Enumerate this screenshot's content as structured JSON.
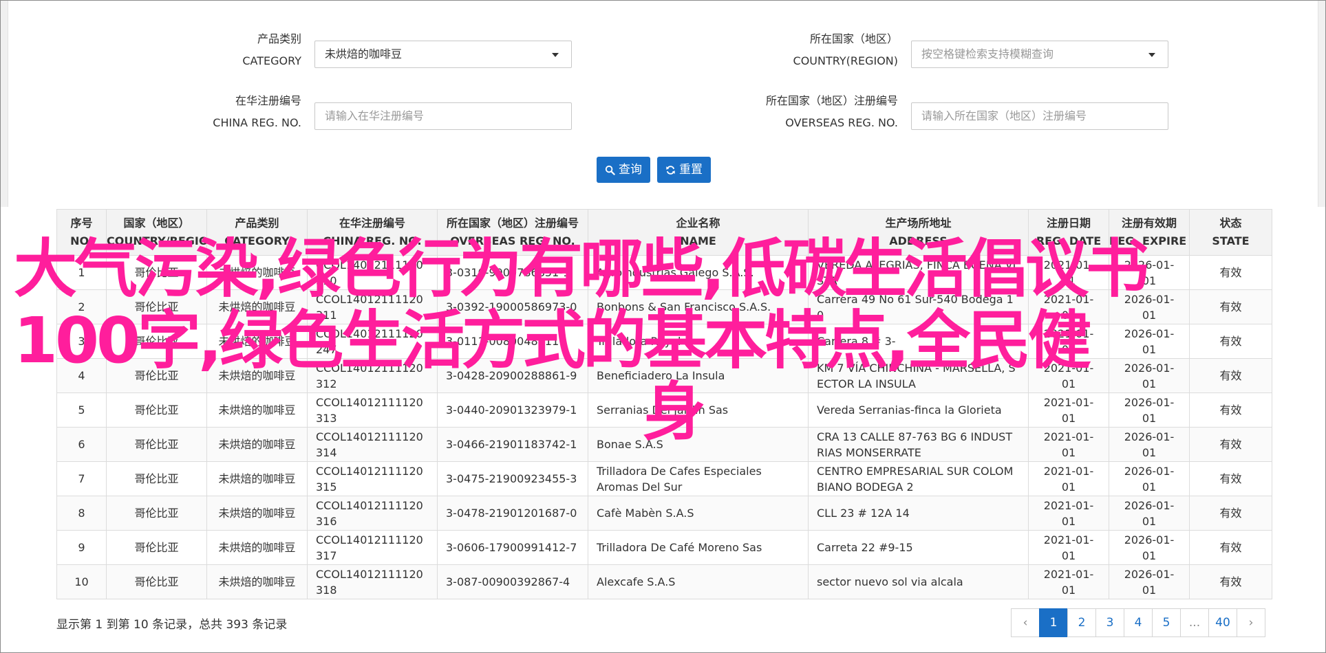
{
  "filters": {
    "category_label_cn": "产品类别",
    "category_label_en": "CATEGORY",
    "category_value": "未烘焙的咖啡豆",
    "country_label_cn": "所在国家（地区）",
    "country_label_en": "COUNTRY(REGION)",
    "country_placeholder": "按空格键检索支持模糊查询",
    "china_reg_label_cn": "在华注册编号",
    "china_reg_label_en": "CHINA REG. NO.",
    "china_reg_placeholder": "请输入在华注册编号",
    "overseas_reg_label_cn": "所在国家（地区）注册编号",
    "overseas_reg_label_en": "OVERSEAS REG. NO.",
    "overseas_reg_placeholder": "请输入所在国家（地区）注册编号",
    "search_label": "查询",
    "reset_label": "重置"
  },
  "table": {
    "columns": [
      {
        "cn": "序号",
        "en": "NO."
      },
      {
        "cn": "国家（地区）",
        "en": "COUNTRY/REGIO"
      },
      {
        "cn": "产品类别",
        "en": "CATEGORY"
      },
      {
        "cn": "在华注册编号",
        "en": "CHINA REG. NO."
      },
      {
        "cn": "所在国家（地区）注册编号",
        "en": "OVERSEAS REG. NO."
      },
      {
        "cn": "企业名称",
        "en": "NAME"
      },
      {
        "cn": "生产场所地址",
        "en": "ADDRESS"
      },
      {
        "cn": "注册日期",
        "en": "REG. DATE"
      },
      {
        "cn": "注册有效期",
        "en": "REG. EXPIRE ..."
      },
      {
        "cn": "状态",
        "en": "STATE"
      }
    ],
    "rows": [
      {
        "no": "1",
        "country": "哥伦比亚",
        "category": "未烘焙的咖啡豆",
        "china_reg": "CCOL14012111120310",
        "overseas_reg": "3-0310-9900786851-1",
        "name": "Agroindustrias Galego S.A.S.",
        "address": "VEREDA ALEGRIAS, FINCA BUENA VISTA",
        "reg_date": "2021-01-01",
        "expire": "2026-01-01",
        "state": "有效"
      },
      {
        "no": "2",
        "country": "哥伦比亚",
        "category": "未烘焙的咖啡豆",
        "china_reg": "CCOL14012111120311",
        "overseas_reg": "3-0392-19000586973-0",
        "name": "Bonbons & San Francisco S.A.S.",
        "address": "Carrera 49 No 61 Sur-540 Bodega 10",
        "reg_date": "2021-01-01",
        "expire": "2026-01-01",
        "state": "有效"
      },
      {
        "no": "3",
        "country": "哥伦比亚",
        "category": "未烘焙的咖啡豆",
        "china_reg": "CCOL14012111120247",
        "overseas_reg": "3-0111-0080048311",
        "name": "Trilladora Royal",
        "address": "Carrera 8 # 3-",
        "reg_date": "2021-01-01",
        "expire": "2026-01-01",
        "state": "有效"
      },
      {
        "no": "4",
        "country": "哥伦比亚",
        "category": "未烘焙的咖啡豆",
        "china_reg": "CCOL14012111120312",
        "overseas_reg": "3-0428-20900288861-9",
        "name": "Beneficiadero La Insula",
        "address": "KM 7 VÍA CHINCHINA - MARSELLA, SECTOR LA INSULA",
        "reg_date": "2021-01-01",
        "expire": "2026-01-01",
        "state": "有效"
      },
      {
        "no": "5",
        "country": "哥伦比亚",
        "category": "未烘焙的咖啡豆",
        "china_reg": "CCOL14012111120313",
        "overseas_reg": "3-0440-20901323979-1",
        "name": "Serranias Del Jardin Sas",
        "address": "Vereda Serranias-finca la Glorieta",
        "reg_date": "2021-01-01",
        "expire": "2026-01-01",
        "state": "有效"
      },
      {
        "no": "6",
        "country": "哥伦比亚",
        "category": "未烘焙的咖啡豆",
        "china_reg": "CCOL14012111120314",
        "overseas_reg": "3-0466-21901183742-1",
        "name": "Bonae S.A.S",
        "address": "CRA 13 CALLE 87-763 BG 6 INDUSTRIAS MONSERRATE",
        "reg_date": "2021-01-01",
        "expire": "2026-01-01",
        "state": "有效"
      },
      {
        "no": "7",
        "country": "哥伦比亚",
        "category": "未烘焙的咖啡豆",
        "china_reg": "CCOL14012111120315",
        "overseas_reg": "3-0475-21900923455-3",
        "name": "Trilladora De Cafes Especiales Aromas Del Sur",
        "address": "CENTRO EMPRESARIAL SUR COLOMBIANO BODEGA 2",
        "reg_date": "2021-01-01",
        "expire": "2026-01-01",
        "state": "有效"
      },
      {
        "no": "8",
        "country": "哥伦比亚",
        "category": "未烘焙的咖啡豆",
        "china_reg": "CCOL14012111120316",
        "overseas_reg": "3-0478-21901201687-0",
        "name": "Cafè Mabèn S.A.S",
        "address": "CLL 23 # 12A 14",
        "reg_date": "2021-01-01",
        "expire": "2026-01-01",
        "state": "有效"
      },
      {
        "no": "9",
        "country": "哥伦比亚",
        "category": "未烘焙的咖啡豆",
        "china_reg": "CCOL14012111120317",
        "overseas_reg": "3-0606-17900991412-7",
        "name": "Trilladora De Café Moreno Sas",
        "address": "Carreta 22 #9-15",
        "reg_date": "2021-01-01",
        "expire": "2026-01-01",
        "state": "有效"
      },
      {
        "no": "10",
        "country": "哥伦比亚",
        "category": "未烘焙的咖啡豆",
        "china_reg": "CCOL14012111120318",
        "overseas_reg": "3-087-00900392867-4",
        "name": "Alexcafe S.A.S",
        "address": "sector nuevo sol via alcala",
        "reg_date": "2021-01-01",
        "expire": "2026-01-01",
        "state": "有效"
      }
    ]
  },
  "footer": {
    "info": "显示第 1 到第 10 条记录，总共 393 条记录",
    "pages": [
      "‹",
      "1",
      "2",
      "3",
      "4",
      "5",
      "...",
      "40",
      "›"
    ],
    "active_page": "1"
  },
  "overlay": {
    "line1": "大气污染,绿色行为有哪些,低碳生活倡议书",
    "line2": "100字,绿色生活方式的基本特点,全民健",
    "line3": "身"
  },
  "colors": {
    "accent": "#1a6fc6",
    "overlay": "#ff1e9c"
  }
}
